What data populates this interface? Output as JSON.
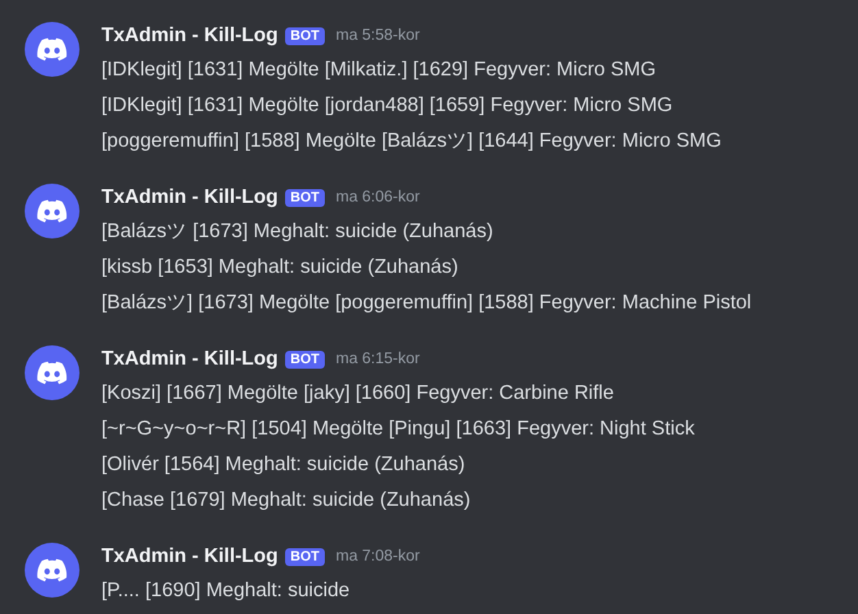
{
  "messages": [
    {
      "author": "TxAdmin - Kill-Log",
      "badge": "BOT",
      "time": "ma 5:58-kor",
      "lines": [
        "[IDKlegit] [1631] Megölte [Milkatiz.] [1629] Fegyver: Micro SMG",
        "[IDKlegit] [1631] Megölte [jordan488] [1659] Fegyver: Micro SMG",
        "[poggeremuffin] [1588] Megölte [Balázsツ] [1644] Fegyver: Micro SMG"
      ]
    },
    {
      "author": "TxAdmin - Kill-Log",
      "badge": "BOT",
      "time": "ma 6:06-kor",
      "lines": [
        "[Balázsツ [1673] Meghalt: suicide (Zuhanás)",
        "[kissb [1653] Meghalt: suicide (Zuhanás)",
        "[Balázsツ] [1673] Megölte [poggeremuffin] [1588] Fegyver: Machine Pistol"
      ]
    },
    {
      "author": "TxAdmin - Kill-Log",
      "badge": "BOT",
      "time": "ma 6:15-kor",
      "lines": [
        "[Koszi] [1667] Megölte [jaky] [1660] Fegyver: Carbine Rifle",
        "[~r~G~y~o~r~R] [1504] Megölte [Pingu] [1663] Fegyver: Night Stick",
        "[Olivér [1564] Meghalt: suicide (Zuhanás)",
        "[Chase [1679] Meghalt: suicide (Zuhanás)"
      ]
    },
    {
      "author": "TxAdmin - Kill-Log",
      "badge": "BOT",
      "time": "ma 7:08-kor",
      "lines": [
        "[P.... [1690] Meghalt: suicide"
      ]
    }
  ]
}
